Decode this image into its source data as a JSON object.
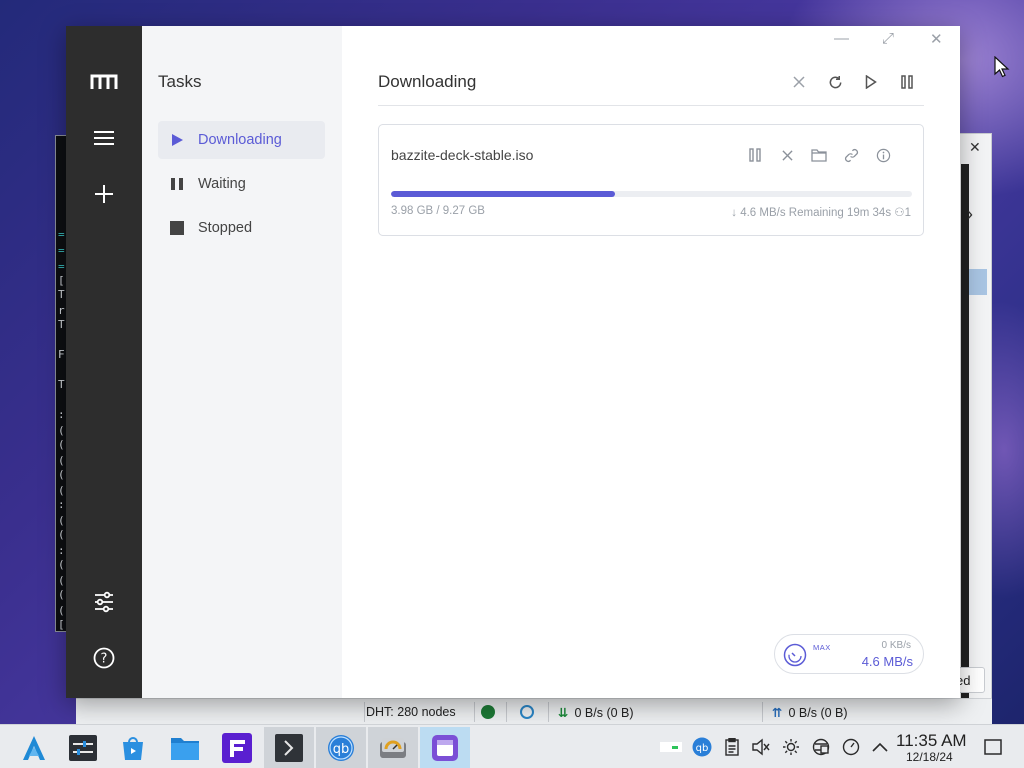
{
  "sidebar": {
    "title": "Tasks",
    "items": [
      {
        "label": "Downloading",
        "active": true
      },
      {
        "label": "Waiting",
        "active": false
      },
      {
        "label": "Stopped",
        "active": false
      }
    ]
  },
  "main": {
    "title": "Downloading",
    "task": {
      "name": "bazzite-deck-stable.iso",
      "progress_fraction": 0.43,
      "sizes": "3.98 GB / 9.27 GB",
      "speed": "4.6 MB/s",
      "remaining": "Remaining 19m 34s",
      "connections": "1"
    },
    "speed_meter": {
      "max_label": "MAX",
      "upload": "0 KB/s",
      "download": "4.6 MB/s"
    }
  },
  "qbittorrent_status": {
    "dht": "DHT: 280 nodes",
    "download": "0 B/s (0 B)",
    "upload": "0 B/s (0 B)",
    "partial_button": "ed"
  },
  "taskbar": {
    "time": "11:35 AM",
    "date": "12/18/24"
  },
  "colors": {
    "accent": "#5b5bd6",
    "rail": "#2d2d2d",
    "tasks_pane": "#f4f5f7"
  }
}
